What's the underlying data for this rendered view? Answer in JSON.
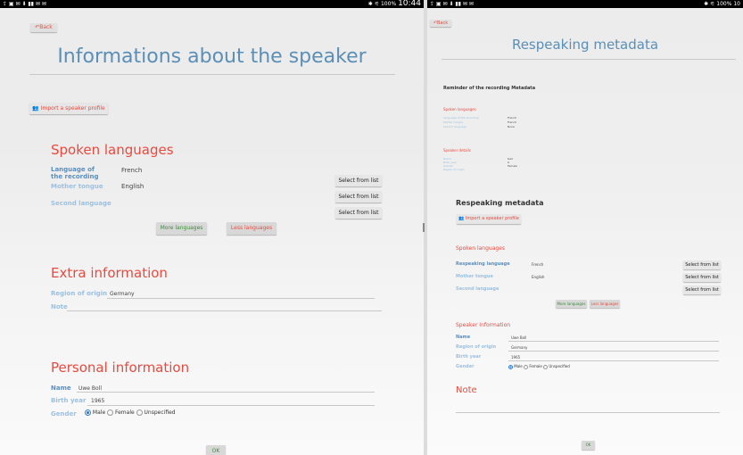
{
  "left": {
    "status": {
      "icons_left": "⇪ ▣ ✉ ⬇ ▮▮ ✉ ✉",
      "icons_right": "✱ ⚟ 100%",
      "time": "10:44"
    },
    "back": "Back",
    "title": "Informations about the speaker",
    "import_btn": "Import a speaker profile",
    "spoken": {
      "heading": "Spoken languages",
      "rows": [
        {
          "label": "Language of the recording",
          "value": "French",
          "btn": "Select from list"
        },
        {
          "label": "Mother tongue",
          "value": "English",
          "btn": "Select from list"
        },
        {
          "label": "Second language",
          "value": "",
          "btn": "Select from list"
        }
      ],
      "more": "More languages",
      "less": "Less languages"
    },
    "extra": {
      "heading": "Extra information",
      "region_label": "Region of origin",
      "region_value": "Germany",
      "note_label": "Note"
    },
    "personal": {
      "heading": "Personal information",
      "name_label": "Name",
      "name_value": "Uwe Boll",
      "birth_label": "Birth year",
      "birth_value": "1965",
      "gender_label": "Gender",
      "male": "Male",
      "female": "Female",
      "unspecified": "Unspecified",
      "selected": "Male"
    },
    "ok": "OK"
  },
  "right": {
    "status": {
      "icons_left": "⇪ ▣ ✉ ⬇ ▮▮ ✉ ✉",
      "icons_right": "✱ ⚟ 100%",
      "time": "10"
    },
    "back": "Back",
    "title": "Respeaking metadata",
    "reminder": {
      "heading": "Reminder of the recording Metadata",
      "spoken_heading": "Spoken languages",
      "spoken_rows": [
        {
          "label": "Language of the recording",
          "value": "French"
        },
        {
          "label": "Mother tongue",
          "value": "French"
        },
        {
          "label": "Second language",
          "value": "None"
        }
      ],
      "speaker_heading": "Speaker details",
      "speaker_rows": [
        {
          "label": "Name",
          "value": "test"
        },
        {
          "label": "Birth year",
          "value": "0"
        },
        {
          "label": "Gender",
          "value": "Female"
        },
        {
          "label": "Region of origin",
          "value": ""
        }
      ]
    },
    "respeaking_heading": "Respeaking metadata",
    "import_btn": "Import a speaker profile",
    "spoken": {
      "heading": "Spoken languages",
      "rows": [
        {
          "label": "Respeaking language",
          "value": "French",
          "btn": "Select from list"
        },
        {
          "label": "Mother tongue",
          "value": "English",
          "btn": "Select from list"
        },
        {
          "label": "Second language",
          "value": "",
          "btn": "Select from list"
        }
      ],
      "more": "More languages",
      "less": "Less languages"
    },
    "speaker_info": {
      "heading": "Speaker Information",
      "name_label": "Name",
      "name_value": "Uwe Boll",
      "region_label": "Region of origin",
      "region_value": "Germany",
      "birth_label": "Birth year",
      "birth_value": "1965",
      "gender_label": "Gender",
      "male": "Male",
      "female": "Female",
      "unspecified": "Unspecified",
      "selected": "Male"
    },
    "note_heading": "Note",
    "ok": "OK"
  }
}
